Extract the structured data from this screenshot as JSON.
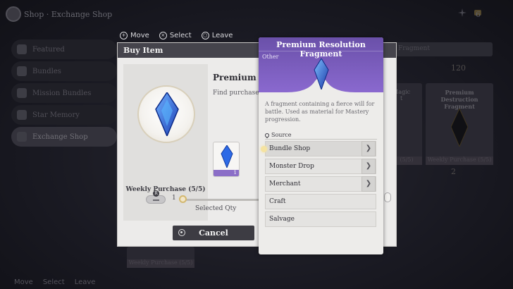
{
  "topbar": {
    "breadcrumb": "Shop · Exchange Shop",
    "right_count": "6"
  },
  "sidebar": {
    "items": [
      {
        "label": "Featured",
        "active": false
      },
      {
        "label": "Bundles",
        "active": false
      },
      {
        "label": "Mission Bundles",
        "active": false
      },
      {
        "label": "Star Memory",
        "active": false
      },
      {
        "label": "Exchange Shop",
        "active": true
      }
    ]
  },
  "controls_top": [
    {
      "icon": "dpad-icon",
      "label": "Move"
    },
    {
      "icon": "x-button-icon",
      "label": "Select"
    },
    {
      "icon": "o-button-icon",
      "label": "Leave"
    }
  ],
  "controls_bottom": [
    {
      "label": "Move"
    },
    {
      "label": "Select"
    },
    {
      "label": "Leave"
    }
  ],
  "bg_cards": {
    "fragment_header": "Fragment",
    "magic_title": "Magic\nt",
    "destruction_title": "Premium Destruction Fragment",
    "weekly_left": "Weekly Purchase (5/5)",
    "weekly_mid": "(5/5)",
    "weekly_right": "Weekly Purchase (5/5)",
    "price_top": "120",
    "price_bottom": "2"
  },
  "dialog": {
    "title": "Buy Item",
    "item_name": "Premium Re",
    "item_desc": "Find purchased",
    "weekly_purchase": "Weekly Purchase (5/5)",
    "thumb_count": "1",
    "qty_min": "1",
    "selected_qty_label": "Selected Qty",
    "minus_badge": "R",
    "cancel_label": "Cancel",
    "slider_value": 0
  },
  "tooltip": {
    "title": "Premium Resolution Fragment",
    "category": "Other",
    "description": "A fragment containing a fierce will for battle. Used as material for Mastery progression.",
    "source_header": "Source",
    "sources": [
      {
        "label": "Bundle Shop",
        "has_arrow": true,
        "selected": true
      },
      {
        "label": "Monster Drop",
        "has_arrow": true,
        "selected": false
      },
      {
        "label": "Merchant",
        "has_arrow": true,
        "selected": false
      },
      {
        "label": "Craft",
        "has_arrow": false,
        "selected": false
      },
      {
        "label": "Salvage",
        "has_arrow": false,
        "selected": false
      }
    ]
  },
  "colors": {
    "rarity_purple": "#8a69cf",
    "crystal_blue": "#2f64e6",
    "header_dark": "#45444c",
    "dialog_bg": "#ecebea"
  }
}
